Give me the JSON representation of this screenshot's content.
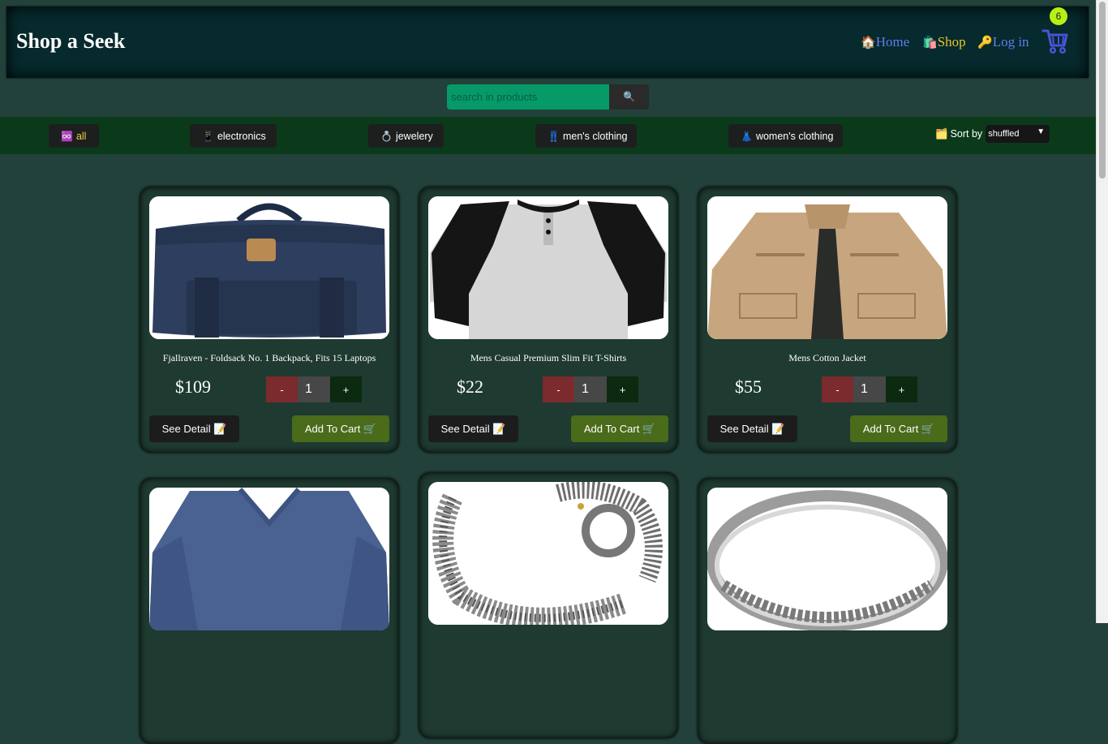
{
  "header": {
    "brand": "Shop a Seek",
    "nav": [
      {
        "icon": "🏠",
        "label": "Home"
      },
      {
        "icon": "🛍️",
        "label": "Shop"
      },
      {
        "icon": "🔑",
        "label": "Log in"
      }
    ],
    "cart_count": "6"
  },
  "search": {
    "placeholder": "search in products",
    "button_icon": "🔍"
  },
  "categories": [
    {
      "icon": "♾️",
      "label": "all"
    },
    {
      "icon": "📱",
      "label": "electronics"
    },
    {
      "icon": "💍",
      "label": "jewelery"
    },
    {
      "icon": "👖",
      "label": "men's clothing"
    },
    {
      "icon": "👗",
      "label": "women's clothing"
    }
  ],
  "sort": {
    "icon": "🗂️",
    "label": "Sort by",
    "selected": "shuffled"
  },
  "card_buttons": {
    "detail_label": "See Detail 📝",
    "cart_label": "Add To Cart 🛒",
    "minus": "-",
    "plus": "+"
  },
  "products": [
    {
      "title": "Fjallraven - Foldsack No. 1 Backpack, Fits 15 Laptops",
      "price": "$109",
      "qty": "1",
      "image": "navy-backpack"
    },
    {
      "title": "Mens Casual Premium Slim Fit T-Shirts",
      "price": "$22",
      "qty": "1",
      "image": "raglan-tshirt"
    },
    {
      "title": "Mens Cotton Jacket",
      "price": "$55",
      "qty": "1",
      "image": "khaki-jacket"
    },
    {
      "image": "blue-longsleeve"
    },
    {
      "image": "dragon-bracelet"
    },
    {
      "image": "silver-ring"
    }
  ]
}
